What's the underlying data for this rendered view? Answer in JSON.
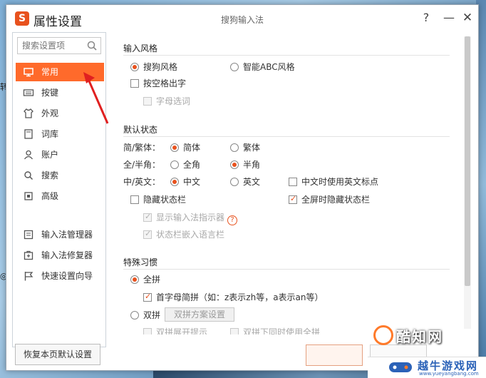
{
  "window": {
    "app_title": "属性设置",
    "logo_glyph": "S",
    "caption": "搜狗输入法",
    "help_glyph": "?",
    "minimize_glyph": "—",
    "close_glyph": "✕"
  },
  "sidebar": {
    "search_placeholder": "搜索设置项",
    "items": [
      {
        "label": "常用",
        "icon": "monitor-icon",
        "active": true
      },
      {
        "label": "按键",
        "icon": "keyboard-icon"
      },
      {
        "label": "外观",
        "icon": "shirt-icon"
      },
      {
        "label": "词库",
        "icon": "book-icon"
      },
      {
        "label": "账户",
        "icon": "user-icon"
      },
      {
        "label": "搜索",
        "icon": "search-icon"
      },
      {
        "label": "高级",
        "icon": "advanced-icon"
      }
    ],
    "tools": [
      {
        "label": "输入法管理器",
        "icon": "manager-icon"
      },
      {
        "label": "输入法修复器",
        "icon": "repair-icon"
      },
      {
        "label": "快速设置向导",
        "icon": "flag-icon"
      }
    ],
    "restore_label": "恢复本页默认设置"
  },
  "content": {
    "input_style": {
      "title": "输入风格",
      "sogou": "搜狗风格",
      "abc": "智能ABC风格",
      "space_output": "按空格出字",
      "letter_select": "字母选词"
    },
    "default_state": {
      "title": "默认状态",
      "simp_trad_label": "简/繁体：",
      "simplified": "简体",
      "traditional": "繁体",
      "width_label": "全/半角：",
      "full_width": "全角",
      "half_width": "半角",
      "lang_label": "中/英文：",
      "chinese": "中文",
      "english": "英文",
      "en_punct": "中文时使用英文标点",
      "hide_status": "隐藏状态栏",
      "fullscreen_hide": "全屏时隐藏状态栏",
      "show_indicator": "显示输入法指示器",
      "indicator_help": "?",
      "embed_lang": "状态栏嵌入语言栏"
    },
    "habits": {
      "title": "特殊习惯",
      "quanpin": "全拼",
      "initials": "首字母简拼（如：z表示zh等，a表示an等）",
      "shuangpin": "双拼",
      "scheme_btn": "双拼方案设置",
      "expand_hint": "双拼展开提示",
      "use_quanpin": "双拼下同时使用全拼"
    }
  },
  "desktop": {
    "frag_1": "转",
    "frag_2": "◎l"
  },
  "watermark": {
    "main": "酷知网",
    "sub": "越牛游戏网",
    "url": "www.yueyangbang.com"
  },
  "colors": {
    "accent": "#ff6a2b",
    "brand": "#e8521e"
  }
}
